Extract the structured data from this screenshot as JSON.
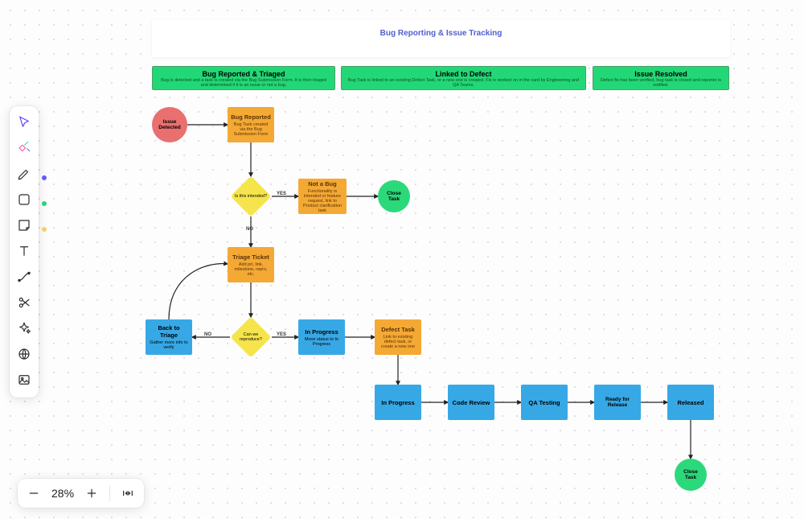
{
  "zoom_level": "28%",
  "page_title": "Bug Reporting & Issue Tracking",
  "toolbar": {
    "tools": [
      "select",
      "magic",
      "pen",
      "shape",
      "sticky",
      "text",
      "connector",
      "scissors",
      "sparkle",
      "globe",
      "image"
    ],
    "selected": "select",
    "color_dots": {
      "pen": "#6a5cff",
      "shape": "#2bd97b",
      "sticky": "#ffd36a"
    }
  },
  "group_headers": [
    {
      "id": "gh1",
      "title": "Bug Reported & Triaged",
      "sub": "Bug is detected and a task is created via the Bug Submission Form. It is then triaged and determined if it is an issue or not a bug."
    },
    {
      "id": "gh2",
      "title": "Linked to Defect",
      "sub": "Bug Task is linked to an existing Defect Task, or a new one is created. Fix is worked on in the card by Engineering and QA Teams."
    },
    {
      "id": "gh3",
      "title": "Issue Resolved",
      "sub": "Defect fix has been verified, bug task is closed and reporter is notified."
    }
  ],
  "nodes": {
    "issueDetected": {
      "title": "Issue Detected"
    },
    "bugReported": {
      "title": "Bug Reported",
      "sub": "Bug Task created via the Bug Submission Form"
    },
    "decisionIntended": {
      "title": "Is this intended?"
    },
    "notABug": {
      "title": "Not a Bug",
      "sub": "Functionality is intended or feature request, link to Product clarification task"
    },
    "closeTask1": {
      "title": "Close Task"
    },
    "triageTicket": {
      "title": "Triage Ticket",
      "sub": "Add pri, link, milestone, repro, etc."
    },
    "canReproduce": {
      "title": "Can we reproduce?"
    },
    "backToTriage": {
      "title": "Back to Triage",
      "sub": "Gather more info to verify"
    },
    "inProgress1": {
      "title": "In Progress",
      "sub": "Move status to In Progress"
    },
    "defectTask": {
      "title": "Defect Task",
      "sub": "Link to existing defect task, or create a new one"
    },
    "inProgress2": {
      "title": "In Progress"
    },
    "codeReview": {
      "title": "Code Review"
    },
    "qaTesting": {
      "title": "QA Testing"
    },
    "readyRelease": {
      "title": "Ready for Release"
    },
    "released": {
      "title": "Released"
    },
    "closeTask2": {
      "title": "Close Task"
    }
  },
  "edge_labels": {
    "yes1": "YES",
    "no1": "NO",
    "no2": "NO",
    "yes2": "YES"
  },
  "chart_data": {
    "type": "flowchart",
    "title": "Bug Reporting & Issue Tracking",
    "swimlanes": [
      {
        "id": "gh1",
        "label": "Bug Reported & Triaged"
      },
      {
        "id": "gh2",
        "label": "Linked to Defect"
      },
      {
        "id": "gh3",
        "label": "Issue Resolved"
      }
    ],
    "nodes": [
      {
        "id": "issueDetected",
        "label": "Issue Detected",
        "shape": "circle",
        "lane": "gh1",
        "fill": "#ea6f6f"
      },
      {
        "id": "bugReported",
        "label": "Bug Reported",
        "shape": "rect",
        "lane": "gh1",
        "fill": "#f4a935"
      },
      {
        "id": "decisionIntended",
        "label": "Is this intended?",
        "shape": "diamond",
        "lane": "gh1",
        "fill": "#f6e44d"
      },
      {
        "id": "notABug",
        "label": "Not a Bug",
        "shape": "rect",
        "lane": "gh1",
        "fill": "#f4a935"
      },
      {
        "id": "closeTask1",
        "label": "Close Task",
        "shape": "circle",
        "lane": "gh1",
        "fill": "#2bd97b"
      },
      {
        "id": "triageTicket",
        "label": "Triage Ticket",
        "shape": "rect",
        "lane": "gh1",
        "fill": "#f4a935"
      },
      {
        "id": "canReproduce",
        "label": "Can we reproduce?",
        "shape": "diamond",
        "lane": "gh1",
        "fill": "#f6e44d"
      },
      {
        "id": "backToTriage",
        "label": "Back to Triage",
        "shape": "rect",
        "lane": "gh1",
        "fill": "#37a8e6"
      },
      {
        "id": "inProgress1",
        "label": "In Progress",
        "shape": "rect",
        "lane": "gh1",
        "fill": "#37a8e6"
      },
      {
        "id": "defectTask",
        "label": "Defect Task",
        "shape": "rect",
        "lane": "gh2",
        "fill": "#f4a935"
      },
      {
        "id": "inProgress2",
        "label": "In Progress",
        "shape": "rect",
        "lane": "gh2",
        "fill": "#37a8e6"
      },
      {
        "id": "codeReview",
        "label": "Code Review",
        "shape": "rect",
        "lane": "gh2",
        "fill": "#37a8e6"
      },
      {
        "id": "qaTesting",
        "label": "QA Testing",
        "shape": "rect",
        "lane": "gh2",
        "fill": "#37a8e6"
      },
      {
        "id": "readyRelease",
        "label": "Ready for Release",
        "shape": "rect",
        "lane": "gh2",
        "fill": "#37a8e6"
      },
      {
        "id": "released",
        "label": "Released",
        "shape": "rect",
        "lane": "gh3",
        "fill": "#37a8e6"
      },
      {
        "id": "closeTask2",
        "label": "Close Task",
        "shape": "circle",
        "lane": "gh3",
        "fill": "#2bd97b"
      }
    ],
    "edges": [
      {
        "from": "issueDetected",
        "to": "bugReported"
      },
      {
        "from": "bugReported",
        "to": "decisionIntended"
      },
      {
        "from": "decisionIntended",
        "to": "notABug",
        "label": "YES"
      },
      {
        "from": "notABug",
        "to": "closeTask1"
      },
      {
        "from": "decisionIntended",
        "to": "triageTicket",
        "label": "NO"
      },
      {
        "from": "triageTicket",
        "to": "canReproduce"
      },
      {
        "from": "canReproduce",
        "to": "backToTriage",
        "label": "NO"
      },
      {
        "from": "backToTriage",
        "to": "triageTicket",
        "curve": true
      },
      {
        "from": "canReproduce",
        "to": "inProgress1",
        "label": "YES"
      },
      {
        "from": "inProgress1",
        "to": "defectTask"
      },
      {
        "from": "defectTask",
        "to": "inProgress2"
      },
      {
        "from": "inProgress2",
        "to": "codeReview"
      },
      {
        "from": "codeReview",
        "to": "qaTesting"
      },
      {
        "from": "qaTesting",
        "to": "readyRelease"
      },
      {
        "from": "readyRelease",
        "to": "released"
      },
      {
        "from": "released",
        "to": "closeTask2"
      }
    ]
  }
}
